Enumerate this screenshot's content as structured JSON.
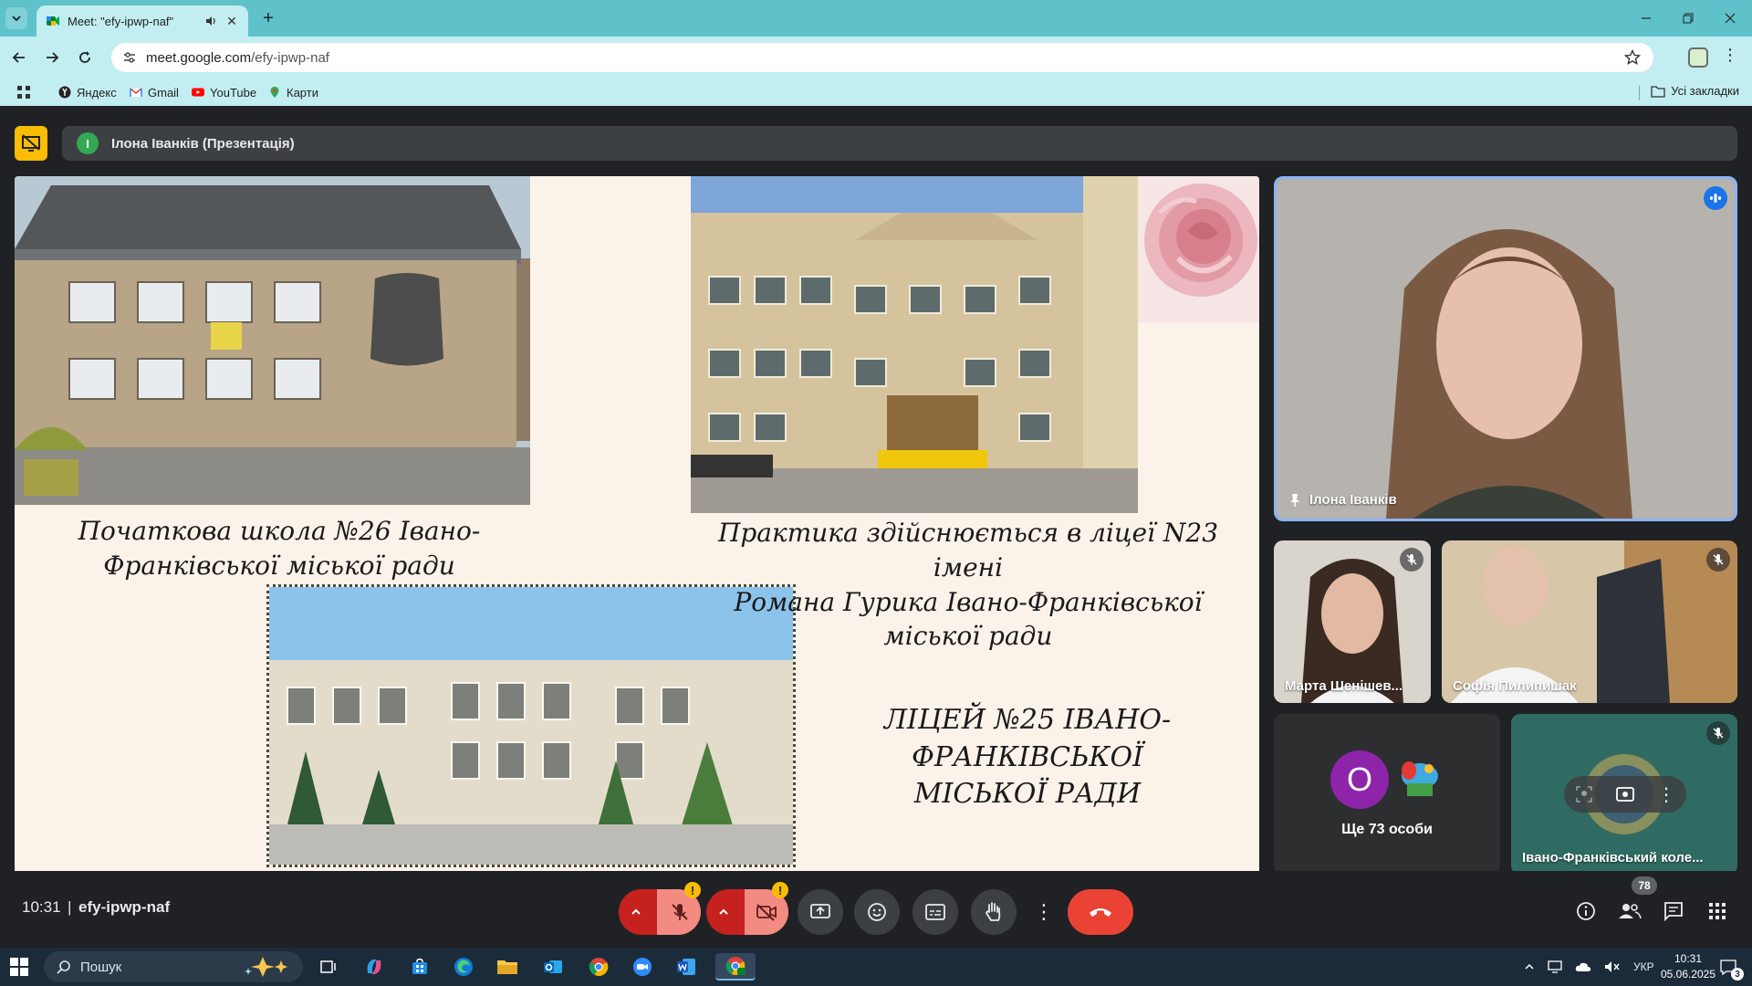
{
  "browser": {
    "tab_title": "Meet: \"efy-ipwp-naf\"",
    "url_host": "meet.google.com",
    "url_path": "/efy-ipwp-naf",
    "bookmarks": [
      "Яндекс",
      "Gmail",
      "YouTube",
      "Карти"
    ],
    "all_bookmarks": "Усі закладки"
  },
  "presenter": {
    "initial": "І",
    "label": "Ілона Іванків (Презентація)"
  },
  "slide": {
    "caption_1_line1": "Початкова школа №26 Івано-",
    "caption_1_line2": "Франківської міської ради",
    "caption_2_line1": "Практика здійснюється в ліцеї N23 імені",
    "caption_2_line2": "Романа Гурика Івано-Франківської міської ради",
    "caption_3_line1": "ЛІЦЕЙ №25 ІВАНО-ФРАНКІВСЬКОЇ",
    "caption_3_line2": "МІСЬКОЇ РАДИ"
  },
  "participants": {
    "main": "Ілона Іванків",
    "p1": "Марта Шенішев...",
    "p2": "Софія Пилипишак",
    "others_initial": "О",
    "others": "Ще 73 особи",
    "p3": "Івано-Франківський коле..."
  },
  "meeting": {
    "time": "10:31",
    "separator": "|",
    "code": "efy-ipwp-naf",
    "people_count": "78",
    "warn": "!"
  },
  "taskbar": {
    "search_placeholder": "Пошук",
    "lang": "УКР",
    "time": "10:31",
    "date": "05.06.2025",
    "notifications": "3"
  },
  "colors": {
    "accent": "#5fc1c9",
    "meet_bg": "#202124",
    "tile_bg": "#3c4043",
    "end_call": "#ea4335",
    "warning": "#fbbc04"
  }
}
